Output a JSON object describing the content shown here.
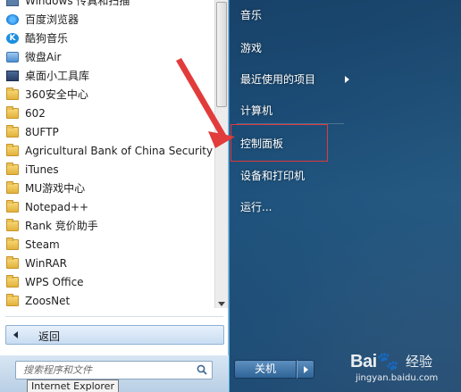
{
  "programs": {
    "items": [
      {
        "label": "Windows 传真和扫描",
        "icon": "fax-scan-icon"
      },
      {
        "label": "百度浏览器",
        "icon": "baidu-browser-icon"
      },
      {
        "label": "酷狗音乐",
        "icon": "kugou-music-icon"
      },
      {
        "label": "微盘Air",
        "icon": "weipan-icon"
      },
      {
        "label": "桌面小工具库",
        "icon": "gadgets-icon"
      },
      {
        "label": "360安全中心",
        "icon": "folder-icon"
      },
      {
        "label": "602",
        "icon": "folder-icon"
      },
      {
        "label": "8UFTP",
        "icon": "folder-icon"
      },
      {
        "label": "Agricultural Bank of China Security S",
        "icon": "folder-icon"
      },
      {
        "label": "iTunes",
        "icon": "folder-icon"
      },
      {
        "label": "MU游戏中心",
        "icon": "folder-icon"
      },
      {
        "label": "Notepad++",
        "icon": "folder-icon"
      },
      {
        "label": "Rank 竞价助手",
        "icon": "folder-icon"
      },
      {
        "label": "Steam",
        "icon": "folder-icon"
      },
      {
        "label": "WinRAR",
        "icon": "folder-icon"
      },
      {
        "label": "WPS Office",
        "icon": "folder-icon"
      },
      {
        "label": "ZoosNet",
        "icon": "folder-icon"
      }
    ],
    "back_label": "返回"
  },
  "search": {
    "placeholder": "搜索程序和文件"
  },
  "tooltip": "Internet Explorer",
  "right_panel": {
    "items": [
      {
        "label": "音乐"
      },
      {
        "label": "游戏"
      },
      {
        "label": "最近使用的项目"
      },
      {
        "label": "计算机"
      },
      {
        "label": "控制面板"
      },
      {
        "label": "设备和打印机"
      },
      {
        "label": "运行..."
      }
    ],
    "shutdown_label": "关机"
  },
  "watermark": {
    "logo": "Bai🐾",
    "text": "经验",
    "url": "jingyan.baidu.com"
  },
  "colors": {
    "highlight_border": "#e0393b",
    "pointer_arrow": "#e23b3b"
  }
}
